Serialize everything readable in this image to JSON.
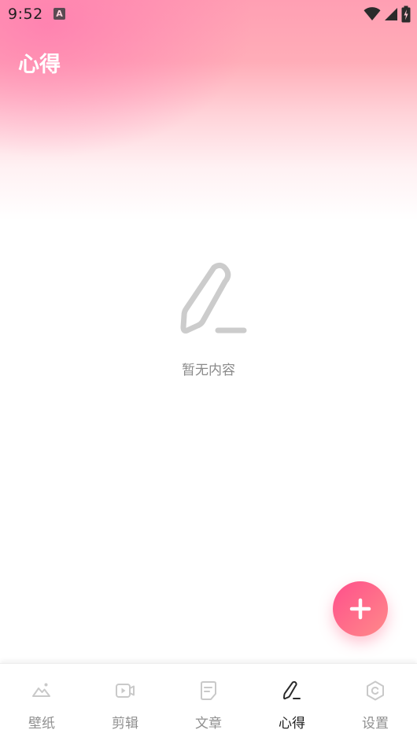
{
  "status_bar": {
    "time": "9:52",
    "app_icon_letter": "A",
    "icons": [
      "wifi-icon",
      "signal-icon",
      "battery-charging-icon"
    ]
  },
  "header": {
    "title": "心得"
  },
  "empty_state": {
    "icon": "pen-icon",
    "text": "暂无内容"
  },
  "fab": {
    "icon": "plus-icon"
  },
  "bottom_nav": {
    "active_index": 3,
    "items": [
      {
        "label": "壁纸",
        "icon": "wallpaper-icon"
      },
      {
        "label": "剪辑",
        "icon": "video-edit-icon"
      },
      {
        "label": "文章",
        "icon": "article-icon"
      },
      {
        "label": "心得",
        "icon": "pen-icon"
      },
      {
        "label": "设置",
        "icon": "settings-icon"
      }
    ]
  },
  "colors": {
    "accent_start": "#ff4f8b",
    "accent_end": "#ff8a8a",
    "header_pink": "#ff9fb3",
    "inactive_text": "#8f8f8f",
    "active_text": "#222222",
    "empty_icon": "#cccccc"
  }
}
